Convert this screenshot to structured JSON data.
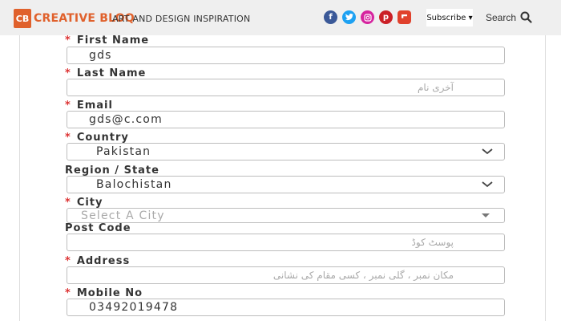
{
  "header": {
    "logo_badge": "CB",
    "logo_text": "CREATIVE BLOQ",
    "tagline": "ART AND DESIGN INSPIRATION",
    "social_icons": [
      "facebook-icon",
      "twitter-icon",
      "instagram-icon",
      "pinterest-icon",
      "flipboard-icon"
    ],
    "subscribe_label": "Subscribe ▾",
    "search_label": "Search"
  },
  "form": {
    "first_name": {
      "label": "First Name",
      "value": "gds",
      "required": true
    },
    "last_name": {
      "label": "Last Name",
      "placeholder": "آخری نام",
      "required": true
    },
    "email": {
      "label": "Email",
      "value": "gds@c.com",
      "required": true
    },
    "country": {
      "label": "Country",
      "value": "Pakistan",
      "required": true
    },
    "region": {
      "label": "Region / State",
      "value": "Balochistan",
      "required": false
    },
    "city": {
      "label": "City",
      "placeholder": "Select A City",
      "required": true
    },
    "post_code": {
      "label": "Post Code",
      "placeholder": "پوسٹ کوڈ",
      "required": false
    },
    "address": {
      "label": "Address",
      "placeholder": "مکان نمبر ، گلی نمبر ، کسی مقام کی نشانی",
      "required": true
    },
    "mobile": {
      "label": "Mobile No",
      "value": "03492019478",
      "required": true
    }
  },
  "colors": {
    "brand": "#e0612c",
    "required_star": "#d33333",
    "header_bg": "#efefef"
  }
}
